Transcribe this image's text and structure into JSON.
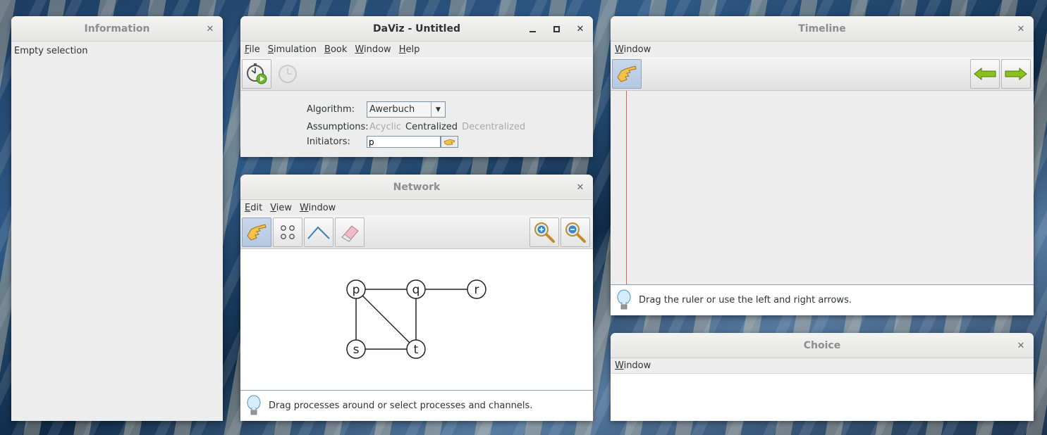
{
  "information": {
    "title": "Information",
    "content": "Empty selection"
  },
  "daviz": {
    "title": "DaViz - Untitled",
    "menu": [
      "File",
      "Simulation",
      "Book",
      "Window",
      "Help"
    ],
    "algorithm_label": "Algorithm:",
    "algorithm_value": "Awerbuch",
    "assumptions_label": "Assumptions:",
    "assumptions": [
      {
        "label": "Acyclic",
        "active": false
      },
      {
        "label": "Centralized",
        "active": true
      },
      {
        "label": "Decentralized",
        "active": false
      }
    ],
    "initiators_label": "Initiators:",
    "initiators_value": "p"
  },
  "network": {
    "title": "Network",
    "menu": [
      "Edit",
      "View",
      "Window"
    ],
    "nodes": [
      {
        "id": "p",
        "label": "p"
      },
      {
        "id": "q",
        "label": "q"
      },
      {
        "id": "r",
        "label": "r"
      },
      {
        "id": "s",
        "label": "s"
      },
      {
        "id": "t",
        "label": "t"
      }
    ],
    "edges": [
      [
        "p",
        "q"
      ],
      [
        "q",
        "r"
      ],
      [
        "p",
        "s"
      ],
      [
        "p",
        "t"
      ],
      [
        "q",
        "t"
      ],
      [
        "s",
        "t"
      ]
    ],
    "hint": "Drag processes around or select processes and channels."
  },
  "timeline": {
    "title": "Timeline",
    "menu": [
      "Window"
    ],
    "hint": "Drag the ruler or use the left and right arrows."
  },
  "choice": {
    "title": "Choice",
    "menu": [
      "Window"
    ]
  },
  "colors": {
    "selected_tool": "#b4c8e2",
    "ruler": "#e06060",
    "arrow_green": "#8bc020"
  }
}
